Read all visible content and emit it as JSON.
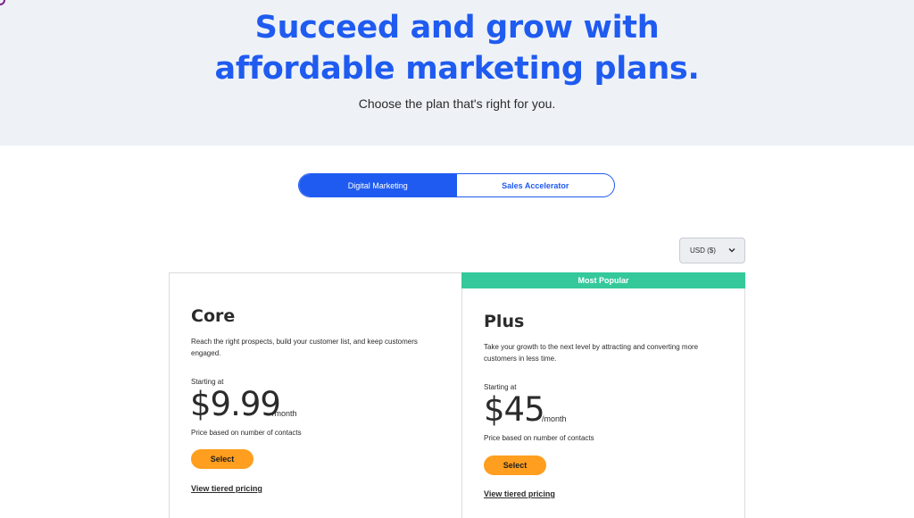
{
  "hero": {
    "title_line1": "Succeed and grow with",
    "title_line2": "affordable marketing plans.",
    "subtitle": "Choose the plan that's right for you."
  },
  "toggle": {
    "options": [
      {
        "label": "Digital Marketing",
        "active": true
      },
      {
        "label": "Sales Accelerator",
        "active": false
      }
    ]
  },
  "currency": {
    "selected": "USD ($)"
  },
  "plans": [
    {
      "name": "Core",
      "description": "Reach the right prospects, build your customer list, and keep customers engaged.",
      "starting_label": "Starting at",
      "price": "$9.99",
      "period": "/month",
      "price_note": "Price based on number of contacts",
      "select_label": "Select",
      "tier_link": "View tiered pricing"
    },
    {
      "badge": "Most Popular",
      "name": "Plus",
      "description": "Take your growth to the next level by attracting and converting more customers in less time.",
      "starting_label": "Starting at",
      "price": "$45",
      "period": "/month",
      "price_note": "Price based on number of contacts",
      "select_label": "Select",
      "tier_link": "View tiered pricing"
    }
  ],
  "colors": {
    "brand_blue": "#1f5bf0",
    "popular_green": "#35c99a",
    "select_orange": "#ff9e1f",
    "hero_bg": "#eef2f7"
  }
}
